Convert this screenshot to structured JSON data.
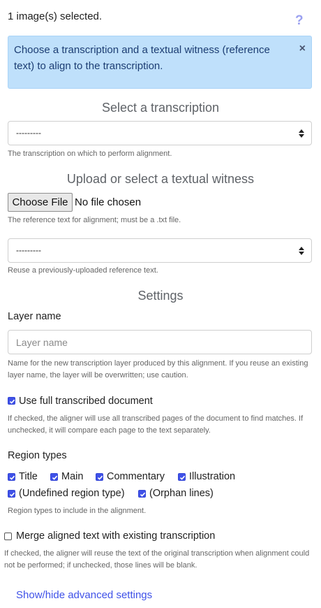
{
  "header": {
    "selection_text": "1 image(s) selected.",
    "help_glyph": "?"
  },
  "alert": {
    "text": "Choose a transcription and a textual witness (reference text) to align to the transcription.",
    "close_glyph": "×"
  },
  "transcription": {
    "title": "Select a transcription",
    "selected_value": "---------",
    "help": "The transcription on which to perform alignment."
  },
  "witness": {
    "title": "Upload or select a textual witness",
    "file_button_label": "Choose File",
    "file_status": "No file chosen",
    "file_help": "The reference text for alignment; must be a .txt file.",
    "select_value": "---------",
    "select_help": "Reuse a previously-uploaded reference text."
  },
  "settings": {
    "title": "Settings",
    "layer_name_label": "Layer name",
    "layer_name_placeholder": "Layer name",
    "layer_name_help": "Name for the new transcription layer produced by this alignment. If you reuse an existing layer name, the layer will be overwritten; use caution.",
    "full_doc_label": "Use full transcribed document",
    "full_doc_checked": true,
    "full_doc_help": "If checked, the aligner will use all transcribed pages of the document to find matches. If unchecked, it will compare each page to the text separately.",
    "region_types_label": "Region types",
    "region_types": [
      {
        "label": "Title",
        "checked": true
      },
      {
        "label": "Main",
        "checked": true
      },
      {
        "label": "Commentary",
        "checked": true
      },
      {
        "label": "Illustration",
        "checked": true
      },
      {
        "label": "(Undefined region type)",
        "checked": true
      },
      {
        "label": "(Orphan lines)",
        "checked": true
      }
    ],
    "region_types_help": "Region types to include in the alignment.",
    "merge_label": "Merge aligned text with existing transcription",
    "merge_checked": false,
    "merge_help": "If checked, the aligner will reuse the text of the original transcription when alignment could not be performed; if unchecked, those lines will be blank.",
    "advanced_link": "Show/hide advanced settings"
  },
  "colors": {
    "accent": "#3f51e8",
    "alert_bg": "#bfe0fb",
    "alert_text": "#1c3d73",
    "help_icon": "#9aa0f0"
  }
}
